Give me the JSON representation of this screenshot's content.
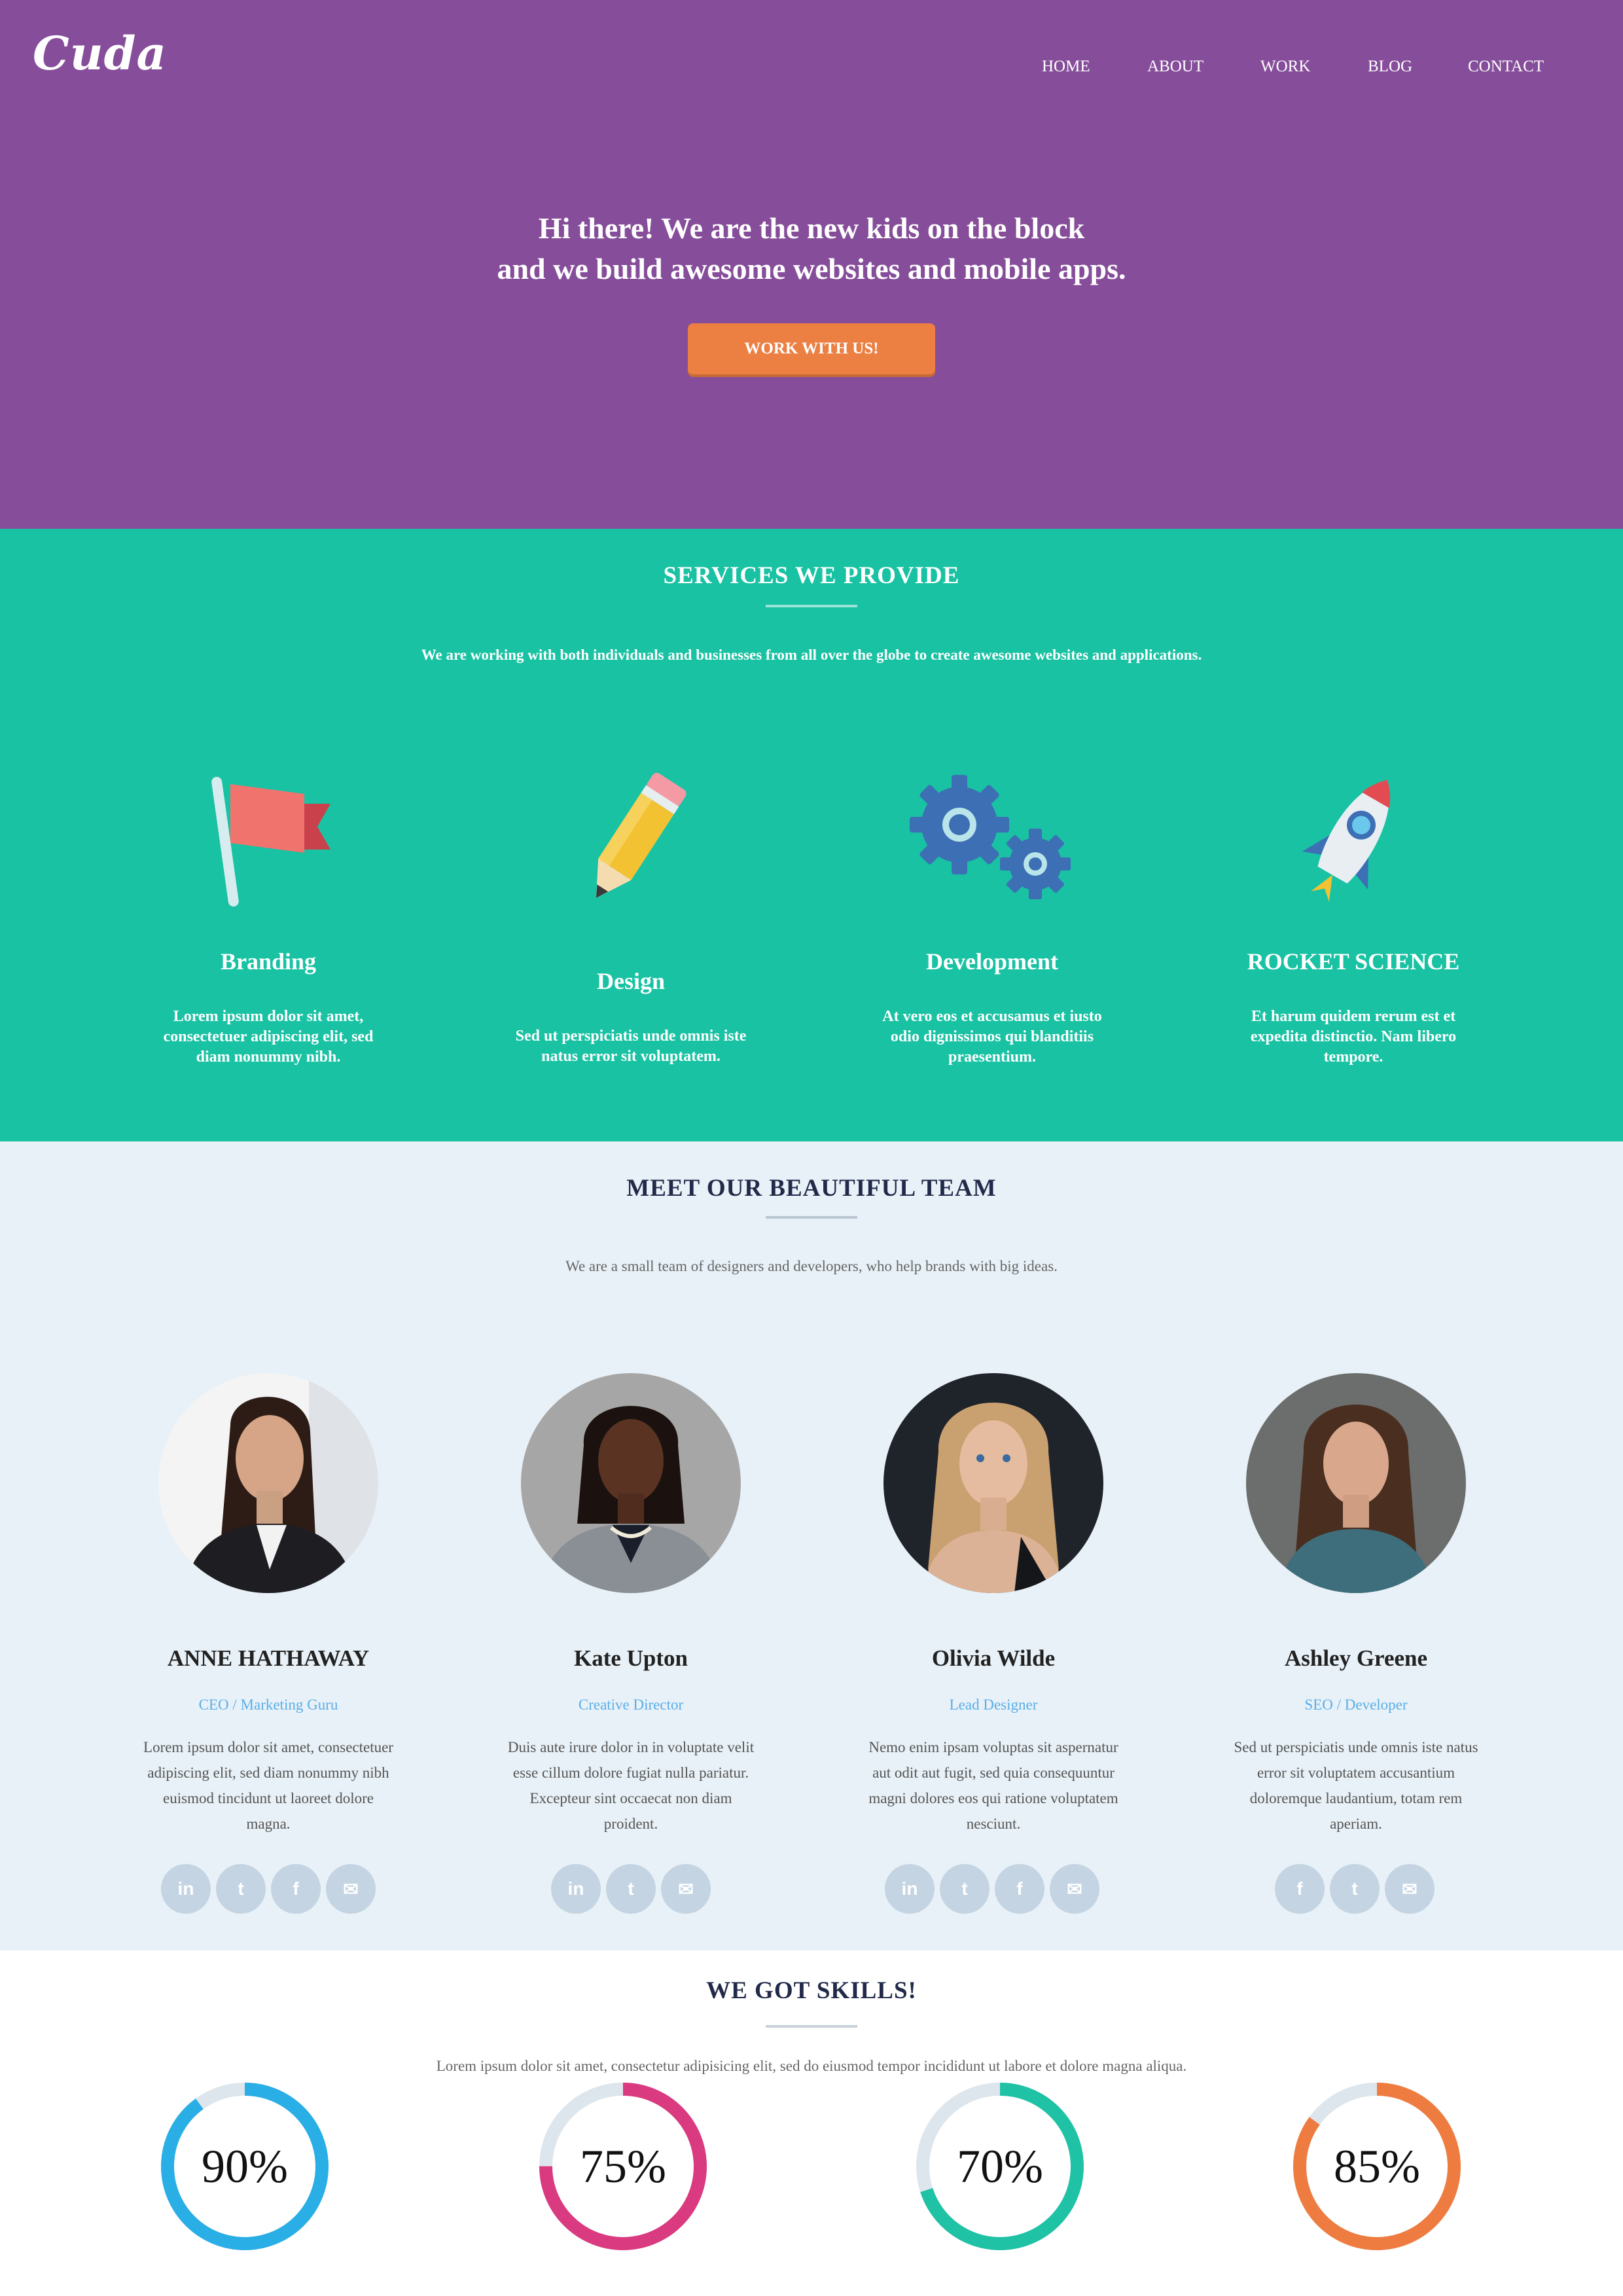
{
  "brand": {
    "logo": "Cuda"
  },
  "nav": [
    "HOME",
    "ABOUT",
    "WORK",
    "BLOG",
    "CONTACT"
  ],
  "hero": {
    "line1": "Hi there! We are the new kids on the block",
    "line2": "and we build awesome websites and mobile apps.",
    "cta": "WORK WITH US!"
  },
  "services": {
    "title": "SERVICES WE PROVIDE",
    "subtitle": "We are working with both individuals and businesses from all over the globe to create awesome websites and applications.",
    "items": [
      {
        "name": "Branding",
        "icon": "flag-icon",
        "desc": [
          "Lorem ipsum dolor sit amet,",
          "consectetuer adipiscing elit, sed",
          "diam nonummy nibh."
        ]
      },
      {
        "name": "Design",
        "icon": "pencil-icon",
        "desc": [
          "Sed ut perspiciatis unde omnis iste",
          "natus error sit voluptatem."
        ]
      },
      {
        "name": "Development",
        "icon": "gears-icon",
        "desc": [
          "At vero eos et accusamus et iusto",
          "odio dignissimos qui blanditiis",
          "praesentium."
        ]
      },
      {
        "name": "ROCKET SCIENCE",
        "icon": "rocket-icon",
        "desc": [
          "Et harum quidem rerum est et",
          "expedita distinctio. Nam libero",
          "tempore."
        ]
      }
    ]
  },
  "team": {
    "title": "MEET OUR BEAUTIFUL TEAM",
    "subtitle": "We are a small team of designers and developers, who help brands with big ideas.",
    "members": [
      {
        "name": "ANNE HATHAWAY",
        "role": "CEO / Marketing Guru",
        "bio": [
          "Lorem ipsum dolor sit amet, consectetuer",
          "adipiscing elit, sed diam nonummy nibh",
          "euismod tincidunt ut laoreet dolore",
          "magna."
        ],
        "socials": [
          "in",
          "t",
          "f",
          "✉"
        ]
      },
      {
        "name": "Kate Upton",
        "role": "Creative Director",
        "bio": [
          "Duis aute irure dolor in in voluptate velit",
          "esse cillum dolore fugiat nulla pariatur.",
          "Excepteur sint occaecat non diam",
          "proident."
        ],
        "socials": [
          "in",
          "t",
          "✉"
        ]
      },
      {
        "name": "Olivia Wilde",
        "role": "Lead Designer",
        "bio": [
          "Nemo enim ipsam voluptas sit aspernatur",
          "aut odit aut fugit, sed quia consequuntur",
          "magni dolores eos qui ratione voluptatem",
          "nesciunt."
        ],
        "socials": [
          "in",
          "t",
          "f",
          "✉"
        ]
      },
      {
        "name": "Ashley Greene",
        "role": "SEO / Developer",
        "bio": [
          "Sed ut perspiciatis unde omnis iste natus",
          "error sit voluptatem accusantium",
          "doloremque laudantium, totam rem",
          "aperiam."
        ],
        "socials": [
          "f",
          "t",
          "✉"
        ]
      }
    ]
  },
  "skills": {
    "title": "WE GOT SKILLS!",
    "subtitle": "Lorem ipsum dolor sit amet, consectetur adipisicing elit, sed do eiusmod tempor incididunt ut labore et dolore magna aliqua.",
    "items": [
      {
        "label": "90%",
        "value": 0.9,
        "color": "#29aee6"
      },
      {
        "label": "75%",
        "value": 0.75,
        "color": "#da3a7f"
      },
      {
        "label": "70%",
        "value": 0.7,
        "color": "#1fc2a5"
      },
      {
        "label": "85%",
        "value": 0.85,
        "color": "#ee7c40"
      }
    ]
  }
}
